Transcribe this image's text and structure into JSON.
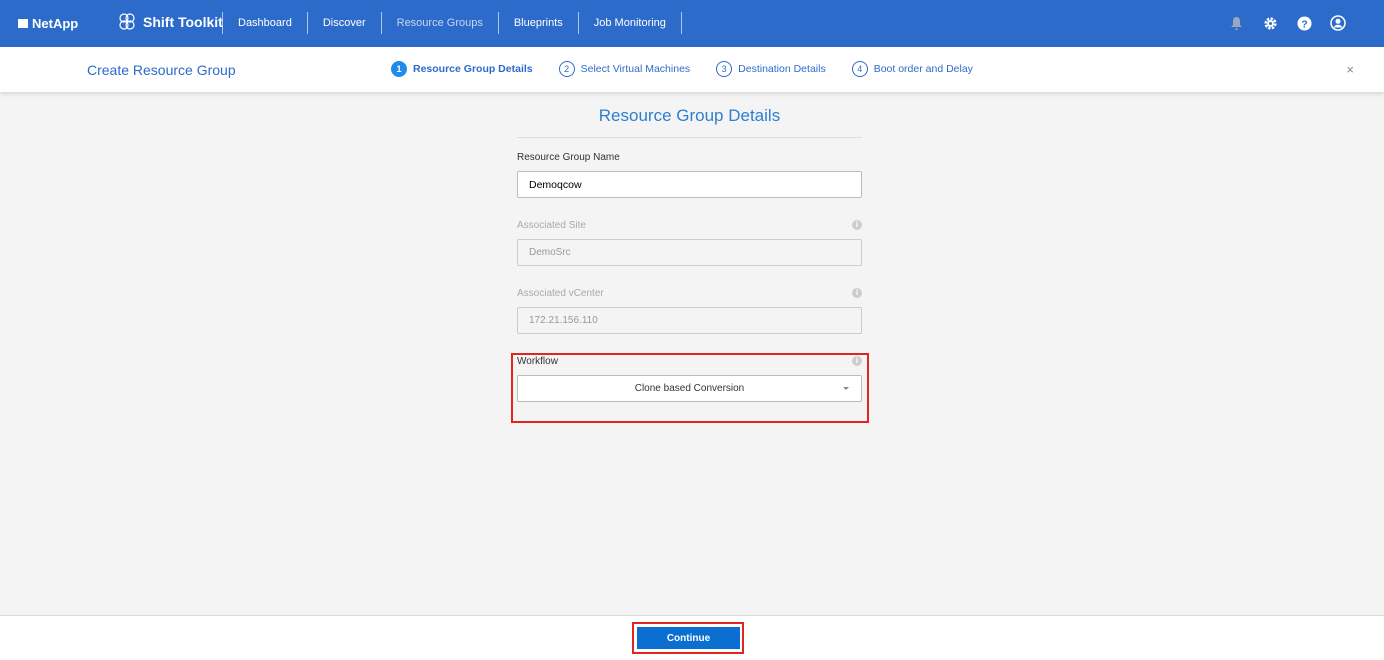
{
  "header": {
    "brand": "NetApp",
    "app": "Shift Toolkit",
    "nav": [
      "Dashboard",
      "Discover",
      "Resource Groups",
      "Blueprints",
      "Job Monitoring"
    ]
  },
  "sub": {
    "title": "Create Resource Group",
    "steps": [
      {
        "n": "1",
        "label": "Resource Group Details"
      },
      {
        "n": "2",
        "label": "Select Virtual Machines"
      },
      {
        "n": "3",
        "label": "Destination Details"
      },
      {
        "n": "4",
        "label": "Boot order and Delay"
      }
    ],
    "close": "×"
  },
  "form": {
    "title": "Resource Group Details",
    "name_label": "Resource Group Name",
    "name_value": "Demoqcow",
    "site_label": "Associated Site",
    "site_value": "DemoSrc",
    "vcenter_label": "Associated vCenter",
    "vcenter_value": "172.21.156.110",
    "workflow_label": "Workflow",
    "workflow_value": "Clone based Conversion"
  },
  "footer": {
    "continue": "Continue"
  },
  "colors": {
    "header": "#2d6bcb",
    "accent": "#1f8ceb",
    "highlight": "#e0261f"
  }
}
